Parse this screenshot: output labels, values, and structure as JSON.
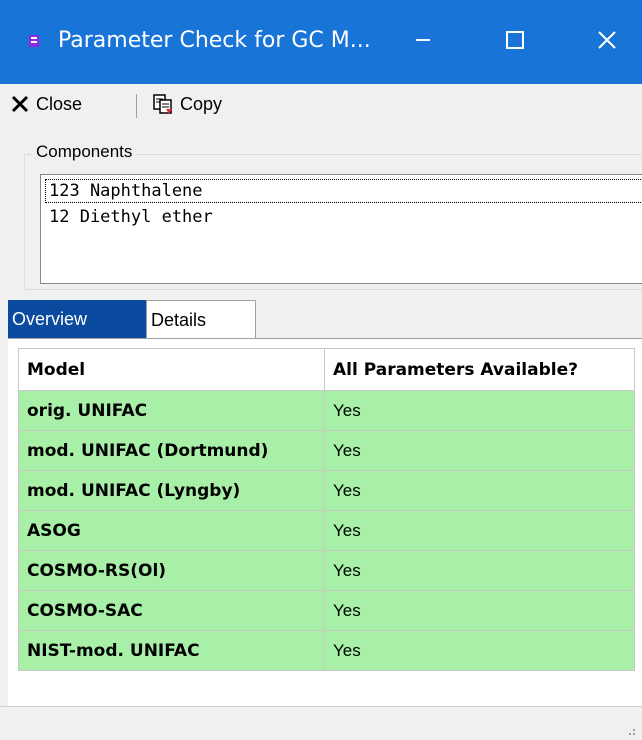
{
  "window": {
    "title": "Parameter Check for GC M...",
    "icon": "app-icon",
    "controls": [
      "minimize-icon",
      "maximize-icon",
      "close-icon"
    ]
  },
  "toolbar": {
    "close_label": "Close",
    "copy_label": "Copy"
  },
  "components": {
    "group_label": "Components",
    "items": [
      "123 Naphthalene",
      "12 Diethyl ether"
    ]
  },
  "tabs": [
    {
      "label": "Overview",
      "active": true
    },
    {
      "label": "Details",
      "active": false
    }
  ],
  "table": {
    "columns": [
      "Model",
      "All Parameters Available?"
    ],
    "rows": [
      [
        "orig. UNIFAC",
        "Yes"
      ],
      [
        "mod. UNIFAC (Dortmund)",
        "Yes"
      ],
      [
        "mod. UNIFAC (Lyngby)",
        "Yes"
      ],
      [
        "ASOG",
        "Yes"
      ],
      [
        "COSMO-RS(Ol)",
        "Yes"
      ],
      [
        "COSMO-SAC",
        "Yes"
      ],
      [
        "NIST-mod. UNIFAC",
        "Yes"
      ]
    ]
  },
  "colors": {
    "titlebar": "#1874d6",
    "active_tab": "#0a4a9f",
    "row_ok": "#a8f0a8"
  }
}
